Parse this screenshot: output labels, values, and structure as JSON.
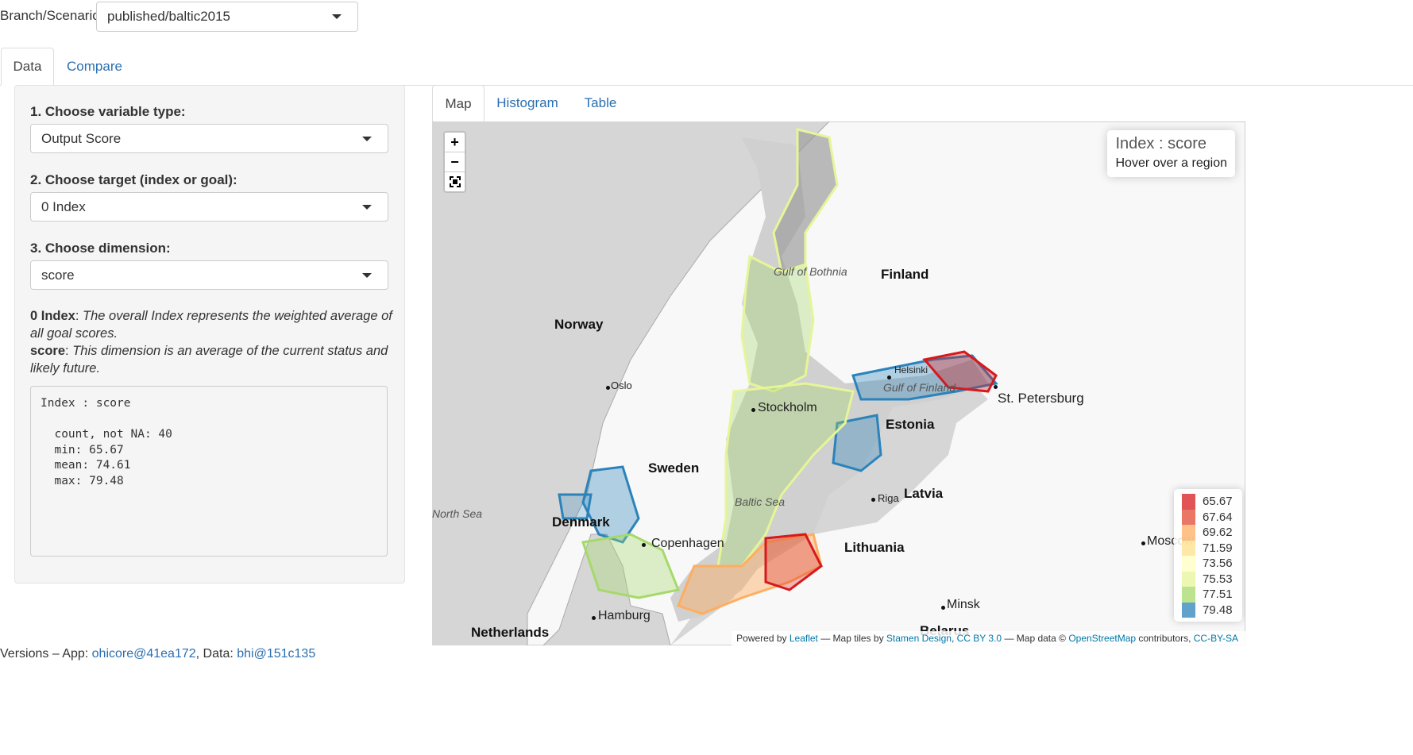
{
  "branch": {
    "label": "Branch/Scenario:",
    "value": "published/baltic2015"
  },
  "main_tabs": [
    {
      "label": "Data",
      "active": true
    },
    {
      "label": "Compare",
      "active": false
    }
  ],
  "controls": {
    "variable_type": {
      "label": "1. Choose variable type:",
      "value": "Output Score"
    },
    "target": {
      "label": "2. Choose target (index or goal):",
      "value": "0 Index"
    },
    "dimension": {
      "label": "3. Choose dimension:",
      "value": "score"
    }
  },
  "description": {
    "target_name": "0 Index",
    "target_text": "The overall Index represents the weighted average of all goal scores.",
    "dimension_name": "score",
    "dimension_text": "This dimension is an average of the current status and likely future."
  },
  "stats": {
    "header": "Index : score",
    "lines": [
      "  count, not NA: 40",
      "  min: 65.67",
      "  mean: 74.61",
      "  max: 79.48"
    ]
  },
  "view_tabs": [
    {
      "label": "Map",
      "active": true
    },
    {
      "label": "Histogram",
      "active": false
    },
    {
      "label": "Table",
      "active": false
    }
  ],
  "map": {
    "zoom_in": "+",
    "zoom_out": "−",
    "fullscreen_icon": "fullscreen-icon",
    "info_title": "Index : score",
    "info_hint": "Hover over a region",
    "legend": [
      {
        "value": "65.67",
        "color": "#d7191c"
      },
      {
        "value": "67.64",
        "color": "#e34a33"
      },
      {
        "value": "69.62",
        "color": "#fdae61"
      },
      {
        "value": "71.59",
        "color": "#fee08b"
      },
      {
        "value": "73.56",
        "color": "#ffffbf"
      },
      {
        "value": "75.53",
        "color": "#e6f598"
      },
      {
        "value": "77.51",
        "color": "#a6d96a"
      },
      {
        "value": "79.48",
        "color": "#2b83ba"
      }
    ],
    "country_labels": [
      "Norway",
      "Sweden",
      "Finland",
      "Estonia",
      "Latvia",
      "Lithuania",
      "Denmark",
      "Netherlands",
      "Belarus"
    ],
    "city_labels": [
      "Oslo",
      "Stockholm",
      "Helsinki",
      "St. Petersburg",
      "Riga",
      "Copenhagen",
      "Hamburg",
      "Minsk",
      "Moscow"
    ],
    "sea_labels": [
      "Gulf of Bothnia",
      "Gulf of Finland",
      "Baltic Sea",
      "North Sea"
    ],
    "attribution": {
      "prefix": "Powered by ",
      "leaflet": "Leaflet",
      "tiles_text": " — Map tiles by ",
      "stamen": "Stamen Design",
      "sep": ", ",
      "ccby": "CC BY 3.0",
      "data_text": " — Map data © ",
      "osm": "OpenStreetMap",
      "contrib": " contributors, ",
      "ccbysa": "CC-BY-SA"
    }
  },
  "footer": {
    "prefix": "Versions – App: ",
    "app_link": "ohicore@41ea172",
    "mid": ", Data: ",
    "data_link": "bhi@151c135"
  }
}
